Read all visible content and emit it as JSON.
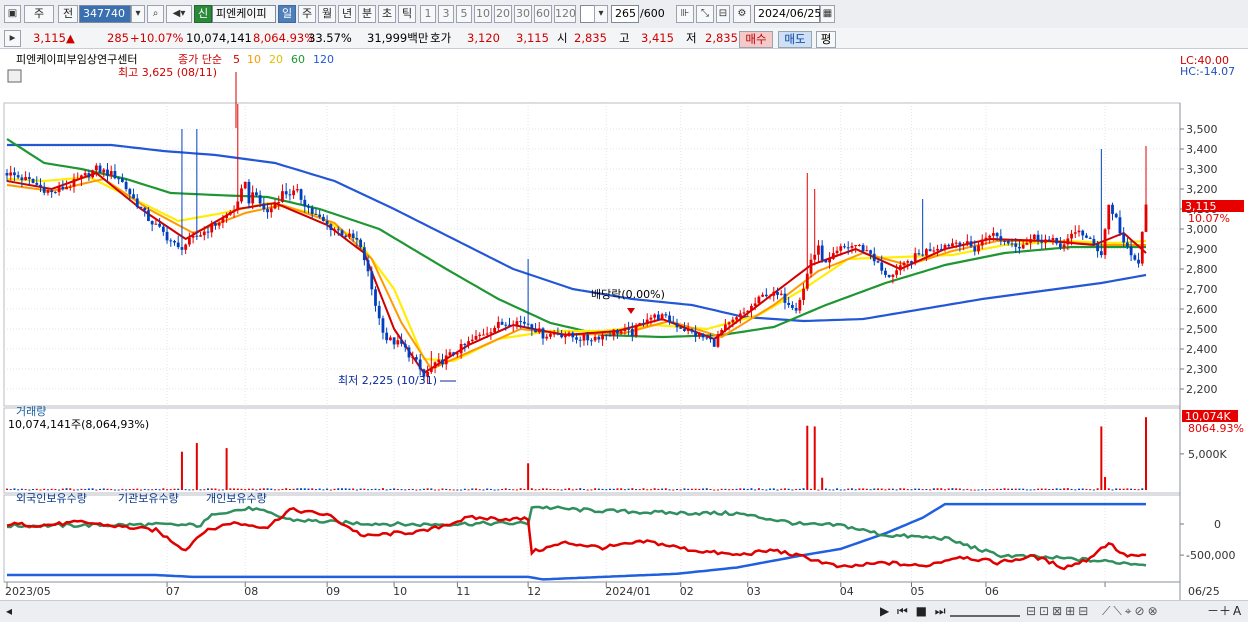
{
  "toolbar": {
    "mode_a": "주",
    "mode_b": "전",
    "code": "347740",
    "badge": "신",
    "name": "피엔케이피",
    "periods": [
      "일",
      "주",
      "월",
      "년",
      "분",
      "초",
      "틱"
    ],
    "ticks": [
      "1",
      "3",
      "5",
      "10",
      "20",
      "30",
      "60",
      "120"
    ],
    "count": "265",
    "count_total": "/600",
    "date": "2024/06/25"
  },
  "quote": {
    "price": "3,115",
    "arrow": "▲",
    "change": "285",
    "change_pct": "+10.07%",
    "volume": "10,074,141",
    "vol_ratio": "8,064.93%",
    "turnover": "33.57%",
    "amount": "31,999백만",
    "ask_label": "호가",
    "ask": "3,120",
    "bid": "3,115",
    "open_label": "시",
    "open": "2,835",
    "high_label": "고",
    "high": "3,415",
    "low_label": "저",
    "low": "2,835",
    "buy": "매수",
    "sell": "매도",
    "avg": "평"
  },
  "colors": {
    "up": "#e60000",
    "down": "#0040c0",
    "ma5": "#d00000",
    "ma10": "#ff9900",
    "ma20": "#ffee00",
    "ma60": "#1e9632",
    "ma120": "#2457d6",
    "foreign": "#e00000",
    "inst": "#2f8f5f",
    "indiv": "#2060e0"
  },
  "chart_data": [
    {
      "type": "candlestick",
      "title": "피엔케이피부임상연구센터",
      "legend": {
        "prefix": "종가 단순",
        "periods": [
          "5",
          "10",
          "20",
          "60",
          "120"
        ]
      },
      "x_labels": [
        "2023/05",
        "07",
        "08",
        "09",
        "10",
        "11",
        "12",
        "2024/01",
        "02",
        "03",
        "04",
        "05",
        "06",
        "06/25"
      ],
      "y_ticks": [
        2200,
        2300,
        2400,
        2500,
        2600,
        2700,
        2800,
        2900,
        3000,
        3100,
        3200,
        3300,
        3400,
        3500
      ],
      "ylim": [
        2130,
        3620
      ],
      "lc": "LC:40.00",
      "hc": "HC:-14.07",
      "last_price_label": "3,115",
      "last_pct_label": "10.07%",
      "annotations": {
        "high": "최고 3,625 (08/11)",
        "low": "최저 2,225 (10/31)",
        "dividend": "배당락(0.00%)"
      },
      "price_path": [
        [
          0,
          3280
        ],
        [
          6,
          3240
        ],
        [
          12,
          3180
        ],
        [
          18,
          3230
        ],
        [
          24,
          3300
        ],
        [
          30,
          3260
        ],
        [
          34,
          3150
        ],
        [
          38,
          3050
        ],
        [
          42,
          2980
        ],
        [
          46,
          2900
        ],
        [
          50,
          2950
        ],
        [
          54,
          3000
        ],
        [
          58,
          3050
        ],
        [
          62,
          3120
        ],
        [
          64,
          3250
        ],
        [
          65,
          3120
        ],
        [
          66,
          3200
        ],
        [
          67,
          3150
        ],
        [
          70,
          3080
        ],
        [
          74,
          3180
        ],
        [
          78,
          3180
        ],
        [
          82,
          3080
        ],
        [
          86,
          3020
        ],
        [
          90,
          2980
        ],
        [
          94,
          2940
        ],
        [
          96,
          2850
        ],
        [
          98,
          2700
        ],
        [
          100,
          2550
        ],
        [
          102,
          2450
        ],
        [
          106,
          2420
        ],
        [
          110,
          2330
        ],
        [
          112,
          2260
        ],
        [
          114,
          2300
        ],
        [
          116,
          2330
        ],
        [
          120,
          2380
        ],
        [
          124,
          2430
        ],
        [
          128,
          2480
        ],
        [
          132,
          2520
        ],
        [
          136,
          2540
        ],
        [
          140,
          2530
        ],
        [
          144,
          2470
        ],
        [
          148,
          2480
        ],
        [
          152,
          2460
        ],
        [
          156,
          2450
        ],
        [
          160,
          2470
        ],
        [
          164,
          2490
        ],
        [
          168,
          2480
        ],
        [
          172,
          2560
        ],
        [
          176,
          2560
        ],
        [
          180,
          2520
        ],
        [
          184,
          2480
        ],
        [
          188,
          2450
        ],
        [
          190,
          2430
        ],
        [
          192,
          2490
        ],
        [
          196,
          2550
        ],
        [
          200,
          2610
        ],
        [
          204,
          2680
        ],
        [
          208,
          2660
        ],
        [
          212,
          2610
        ],
        [
          214,
          2700
        ],
        [
          216,
          2850
        ],
        [
          218,
          2900
        ],
        [
          220,
          2820
        ],
        [
          224,
          2900
        ],
        [
          228,
          2920
        ],
        [
          232,
          2880
        ],
        [
          234,
          2820
        ],
        [
          236,
          2760
        ],
        [
          240,
          2800
        ],
        [
          244,
          2860
        ],
        [
          248,
          2900
        ],
        [
          252,
          2920
        ],
        [
          256,
          2940
        ],
        [
          260,
          2900
        ],
        [
          264,
          2980
        ],
        [
          268,
          2940
        ],
        [
          272,
          2920
        ],
        [
          276,
          2960
        ],
        [
          280,
          2940
        ],
        [
          284,
          2920
        ],
        [
          288,
          3000
        ],
        [
          290,
          2950
        ],
        [
          292,
          2920
        ],
        [
          294,
          2880
        ],
        [
          296,
          3120
        ],
        [
          298,
          3050
        ],
        [
          300,
          2930
        ],
        [
          302,
          2860
        ],
        [
          304,
          2830
        ],
        [
          306,
          3115
        ]
      ],
      "ma5_path": [
        [
          0,
          3240
        ],
        [
          12,
          3200
        ],
        [
          24,
          3280
        ],
        [
          36,
          3100
        ],
        [
          48,
          2950
        ],
        [
          62,
          3100
        ],
        [
          72,
          3130
        ],
        [
          86,
          3020
        ],
        [
          96,
          2880
        ],
        [
          104,
          2500
        ],
        [
          112,
          2280
        ],
        [
          124,
          2420
        ],
        [
          136,
          2520
        ],
        [
          150,
          2470
        ],
        [
          164,
          2490
        ],
        [
          176,
          2550
        ],
        [
          190,
          2450
        ],
        [
          204,
          2650
        ],
        [
          216,
          2820
        ],
        [
          228,
          2900
        ],
        [
          240,
          2800
        ],
        [
          252,
          2900
        ],
        [
          264,
          2950
        ],
        [
          280,
          2940
        ],
        [
          292,
          2920
        ],
        [
          300,
          2980
        ],
        [
          306,
          2880
        ]
      ],
      "ma10_path": [
        [
          0,
          3220
        ],
        [
          12,
          3190
        ],
        [
          26,
          3250
        ],
        [
          38,
          3100
        ],
        [
          50,
          2980
        ],
        [
          64,
          3080
        ],
        [
          74,
          3120
        ],
        [
          88,
          3030
        ],
        [
          98,
          2850
        ],
        [
          106,
          2530
        ],
        [
          114,
          2300
        ],
        [
          126,
          2400
        ],
        [
          138,
          2500
        ],
        [
          152,
          2470
        ],
        [
          166,
          2480
        ],
        [
          178,
          2540
        ],
        [
          192,
          2460
        ],
        [
          206,
          2620
        ],
        [
          218,
          2790
        ],
        [
          230,
          2880
        ],
        [
          242,
          2820
        ],
        [
          254,
          2890
        ],
        [
          266,
          2940
        ],
        [
          282,
          2940
        ],
        [
          294,
          2920
        ],
        [
          306,
          2920
        ]
      ],
      "ma20_path": [
        [
          0,
          3250
        ],
        [
          10,
          3240
        ],
        [
          22,
          3260
        ],
        [
          34,
          3150
        ],
        [
          46,
          3040
        ],
        [
          58,
          3080
        ],
        [
          70,
          3130
        ],
        [
          82,
          3080
        ],
        [
          94,
          2950
        ],
        [
          104,
          2700
        ],
        [
          112,
          2350
        ],
        [
          120,
          2340
        ],
        [
          132,
          2450
        ],
        [
          146,
          2490
        ],
        [
          160,
          2490
        ],
        [
          174,
          2520
        ],
        [
          188,
          2500
        ],
        [
          202,
          2570
        ],
        [
          214,
          2700
        ],
        [
          226,
          2850
        ],
        [
          240,
          2860
        ],
        [
          254,
          2870
        ],
        [
          268,
          2920
        ],
        [
          284,
          2940
        ],
        [
          298,
          2930
        ],
        [
          306,
          2940
        ]
      ],
      "ma60_path": [
        [
          0,
          3450
        ],
        [
          10,
          3330
        ],
        [
          20,
          3300
        ],
        [
          32,
          3250
        ],
        [
          44,
          3180
        ],
        [
          56,
          3170
        ],
        [
          70,
          3160
        ],
        [
          84,
          3100
        ],
        [
          100,
          3000
        ],
        [
          118,
          2800
        ],
        [
          132,
          2650
        ],
        [
          146,
          2530
        ],
        [
          160,
          2470
        ],
        [
          176,
          2460
        ],
        [
          192,
          2470
        ],
        [
          206,
          2510
        ],
        [
          220,
          2620
        ],
        [
          236,
          2730
        ],
        [
          252,
          2820
        ],
        [
          268,
          2880
        ],
        [
          286,
          2910
        ],
        [
          306,
          2910
        ]
      ],
      "ma120_path": [
        [
          0,
          3420
        ],
        [
          14,
          3420
        ],
        [
          28,
          3420
        ],
        [
          42,
          3390
        ],
        [
          56,
          3370
        ],
        [
          72,
          3330
        ],
        [
          88,
          3240
        ],
        [
          104,
          3100
        ],
        [
          120,
          2950
        ],
        [
          136,
          2800
        ],
        [
          152,
          2700
        ],
        [
          168,
          2650
        ],
        [
          184,
          2620
        ],
        [
          198,
          2560
        ],
        [
          214,
          2540
        ],
        [
          230,
          2550
        ],
        [
          246,
          2600
        ],
        [
          262,
          2650
        ],
        [
          278,
          2690
        ],
        [
          294,
          2730
        ],
        [
          306,
          2770
        ]
      ],
      "spikes": [
        [
          47,
          3500
        ],
        [
          51,
          3500
        ],
        [
          62,
          3625
        ],
        [
          75,
          3230
        ],
        [
          114,
          2390
        ],
        [
          140,
          2850
        ],
        [
          215,
          3280
        ],
        [
          217,
          3200
        ],
        [
          246,
          3150
        ],
        [
          294,
          3400
        ],
        [
          306,
          3415
        ]
      ]
    },
    {
      "type": "bar",
      "title": "거래량",
      "subtitle": "10,074,141주(8,064,93%)",
      "y_ticks_label": [
        "5,000K"
      ],
      "y_ticks": [
        5000
      ],
      "ylim": [
        0,
        10800
      ],
      "last_value_label": "10,074K",
      "last_pct_label": "8064.93%",
      "volumes": [
        [
          47,
          5300
        ],
        [
          51,
          6500
        ],
        [
          59,
          5800
        ],
        [
          140,
          3700
        ],
        [
          215,
          8900
        ],
        [
          217,
          8800
        ],
        [
          219,
          1700
        ],
        [
          294,
          8800
        ],
        [
          295,
          1800
        ],
        [
          306,
          10074
        ]
      ]
    },
    {
      "type": "line",
      "legend": [
        "외국인보유수량",
        "기관보유수량",
        "개인보유수량"
      ],
      "y_ticks": [
        0,
        -500000
      ],
      "y_tick_labels": [
        "0",
        "-500,000"
      ],
      "ylim": [
        -900000,
        450000
      ],
      "foreign": [
        [
          0,
          0
        ],
        [
          10,
          -20000
        ],
        [
          20,
          30000
        ],
        [
          30,
          -40000
        ],
        [
          40,
          -100000
        ],
        [
          48,
          -420000
        ],
        [
          52,
          -150000
        ],
        [
          60,
          20000
        ],
        [
          70,
          -50000
        ],
        [
          76,
          230000
        ],
        [
          86,
          150000
        ],
        [
          96,
          -200000
        ],
        [
          104,
          -150000
        ],
        [
          112,
          -120000
        ],
        [
          124,
          100000
        ],
        [
          136,
          80000
        ],
        [
          140,
          80000
        ],
        [
          141,
          -450000
        ],
        [
          150,
          -300000
        ],
        [
          160,
          -380000
        ],
        [
          172,
          -280000
        ],
        [
          184,
          -420000
        ],
        [
          196,
          -500000
        ],
        [
          206,
          -420000
        ],
        [
          216,
          -560000
        ],
        [
          224,
          -700000
        ],
        [
          236,
          -620000
        ],
        [
          246,
          -680000
        ],
        [
          256,
          -520000
        ],
        [
          266,
          -620000
        ],
        [
          276,
          -520000
        ],
        [
          284,
          -700000
        ],
        [
          290,
          -580000
        ],
        [
          296,
          -300000
        ],
        [
          300,
          -500000
        ],
        [
          306,
          -520000
        ]
      ],
      "inst": [
        [
          0,
          -30000
        ],
        [
          20,
          -20000
        ],
        [
          40,
          -10000
        ],
        [
          52,
          -20000
        ],
        [
          56,
          180000
        ],
        [
          66,
          250000
        ],
        [
          76,
          70000
        ],
        [
          90,
          20000
        ],
        [
          110,
          -10000
        ],
        [
          130,
          10000
        ],
        [
          140,
          10000
        ],
        [
          141,
          280000
        ],
        [
          156,
          220000
        ],
        [
          176,
          180000
        ],
        [
          196,
          170000
        ],
        [
          214,
          -10000
        ],
        [
          224,
          -20000
        ],
        [
          236,
          -180000
        ],
        [
          252,
          -230000
        ],
        [
          266,
          -500000
        ],
        [
          286,
          -560000
        ],
        [
          306,
          -650000
        ]
      ],
      "indiv": [
        [
          0,
          -820000
        ],
        [
          40,
          -820000
        ],
        [
          50,
          -850000
        ],
        [
          140,
          -850000
        ],
        [
          144,
          -890000
        ],
        [
          160,
          -850000
        ],
        [
          180,
          -800000
        ],
        [
          196,
          -700000
        ],
        [
          214,
          -500000
        ],
        [
          224,
          -400000
        ],
        [
          236,
          -150000
        ],
        [
          246,
          100000
        ],
        [
          252,
          320000
        ],
        [
          306,
          320000
        ]
      ]
    }
  ],
  "bottom": {
    "nav_glyphs": "▶ ⏮ ■ ⏭"
  }
}
